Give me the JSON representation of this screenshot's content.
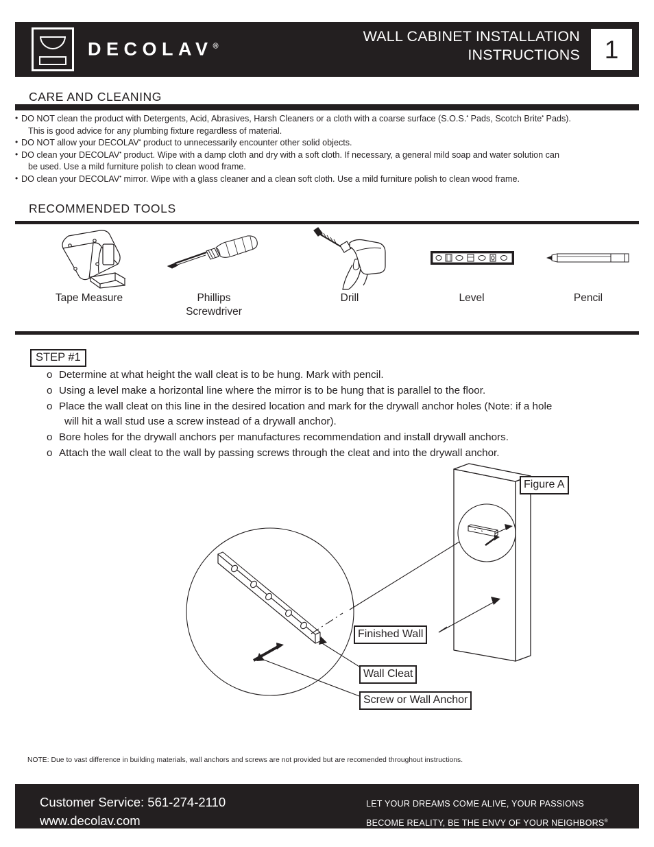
{
  "header": {
    "brand": "DECOLAV",
    "brand_registered": "®",
    "title_line1": "WALL CABINET INSTALLATION",
    "title_line2": "INSTRUCTIONS",
    "page_number": "1",
    "logo_icon": "basin-logo-icon"
  },
  "care": {
    "heading": "CARE AND CLEANING",
    "items": [
      {
        "line1_a": "DO NOT clean the product with Detergents, Acid, Abrasives, Harsh Cleaners or a cloth with a coarse surface (S.O.S.",
        "line1_b": " Pads, Scotch Brite",
        "line1_c": " Pads).",
        "line2": "This is good advice for any plumbing fixture regardless of material."
      },
      {
        "line1_a": "DO NOT allow your DECOLAV",
        "line1_b": " product to unnecessarily encounter other solid objects.",
        "line1_c": "",
        "line2": ""
      },
      {
        "line1_a": "DO clean your DECOLAV",
        "line1_b": " product. Wipe with a damp cloth and dry with a soft cloth. If necessary, a general mild soap and water solution can",
        "line1_c": "",
        "line2": "be used. Use a mild furniture polish to clean wood frame."
      },
      {
        "line1_a": "DO clean your DECOLAV",
        "line1_b": " mirror. Wipe with a glass cleaner and a clean soft cloth. Use a mild furniture polish to clean wood frame.",
        "line1_c": "",
        "line2": ""
      }
    ]
  },
  "tools": {
    "heading": "RECOMMENDED  TOOLS",
    "items": [
      {
        "label": "Tape Measure",
        "icon": "tape-measure-icon"
      },
      {
        "label_line1": "Phillips",
        "label_line2": "Screwdriver",
        "label": "Phillips Screwdriver",
        "icon": "phillips-screwdriver-icon"
      },
      {
        "label": "Drill",
        "icon": "drill-icon"
      },
      {
        "label": "Level",
        "icon": "level-icon"
      },
      {
        "label": "Pencil",
        "icon": "pencil-icon"
      }
    ]
  },
  "step": {
    "badge": "STEP #1",
    "bullet_marker": "o",
    "items": [
      {
        "line1": "Determine at what height the wall cleat is to be hung. Mark with pencil.",
        "line2": ""
      },
      {
        "line1": "Using a level make a horizontal line where the mirror is to be hung that is parallel to the floor.",
        "line2": ""
      },
      {
        "line1": "Place the wall cleat on this line in the desired location and mark for the drywall anchor holes (Note: if a hole",
        "line2": "will hit a wall stud use a screw instead of a drywall anchor)."
      },
      {
        "line1": "Bore holes for the drywall anchors per manufactures recommendation and install drywall anchors.",
        "line2": ""
      },
      {
        "line1": "Attach the wall cleat to the wall by passing screws through the cleat and into the drywall anchor.",
        "line2": ""
      }
    ]
  },
  "figure": {
    "title_label": "Figure A",
    "labels": {
      "finished_wall": "Finished Wall",
      "wall_cleat": "Wall Cleat",
      "screw_or_anchor": "Screw or Wall Anchor"
    }
  },
  "note": {
    "text": "NOTE: Due to vast difference in building materials, wall anchors and screws  are not provided but are recomended throughout instructions."
  },
  "footer": {
    "customer_service": "Customer Service: 561-274-2110",
    "website": "www.decolav.com",
    "tagline_line1": "LET YOUR DREAMS COME ALIVE, YOUR PASSIONS",
    "tagline_line2": "BECOME REALITY, BE THE ENVY OF YOUR NEIGHBORS",
    "tagline_registered": "®"
  },
  "colors": {
    "ink": "#231f20",
    "paper": "#ffffff"
  }
}
